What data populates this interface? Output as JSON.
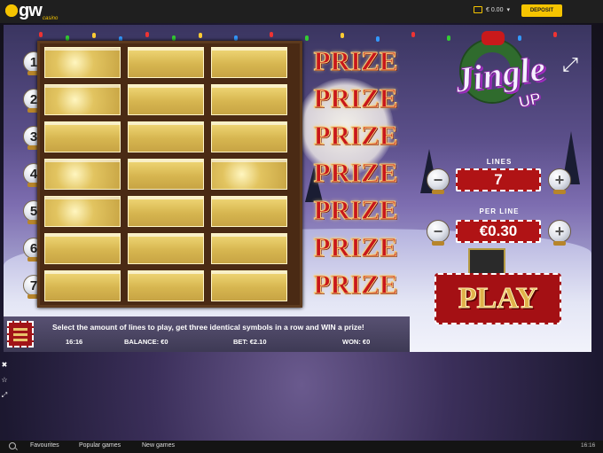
{
  "topbar": {
    "logo_text": "gw",
    "logo_sub": "casino",
    "balance": "€ 0.00",
    "deposit_label": "DEPOSIT"
  },
  "game": {
    "title": "Jingle",
    "title_sub": "UP",
    "lines_buttons": [
      "1",
      "2",
      "3",
      "4",
      "5",
      "6",
      "7"
    ],
    "prize_labels": [
      "PRIZE",
      "PRIZE",
      "PRIZE",
      "PRIZE",
      "PRIZE",
      "PRIZE",
      "PRIZE"
    ],
    "controls": {
      "lines_label": "LINES",
      "lines_value": "7",
      "per_line_label": "PER LINE",
      "per_line_value": "€0.30",
      "minus": "−",
      "plus": "+",
      "play_label": "PLAY"
    },
    "instruction": "Select the amount of lines to play, get three identical symbols in a row and WIN a prize!",
    "status": {
      "time": "16:16",
      "balance": "BALANCE: €0",
      "bet": "BET: €2.10",
      "won": "WON: €0"
    }
  },
  "bottom_nav": {
    "items": [
      "Favourites",
      "Popular games",
      "New games"
    ],
    "clock": "16:16"
  },
  "icons": {
    "fullscreen": "expand-arrows-icon",
    "menu": "hamburger-menu-icon",
    "search": "search-icon"
  },
  "colors": {
    "accent_yellow": "#f5c400",
    "button_red": "#b01315",
    "prize_red": "#c8171b"
  }
}
